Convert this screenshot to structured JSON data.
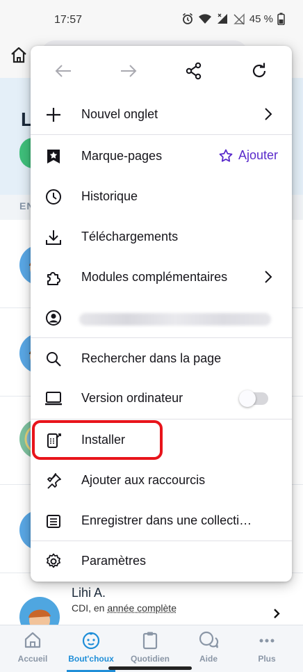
{
  "status_bar": {
    "time": "17:57",
    "battery": "45 %"
  },
  "background_page": {
    "hero_letter": "L",
    "section_label": "EN",
    "last_kid": {
      "name": "Lihi A.",
      "sub_prefix": "CDI, en",
      "sub_link": "année complète"
    },
    "bottom_nav": [
      {
        "label": "Accueil",
        "icon": "house-icon"
      },
      {
        "label": "Bout'choux",
        "icon": "baby-face-icon"
      },
      {
        "label": "Quotidien",
        "icon": "clipboard-icon"
      },
      {
        "label": "Aide",
        "icon": "chat-bubbles-icon"
      },
      {
        "label": "Plus",
        "icon": "more-dots-icon"
      }
    ]
  },
  "menu": {
    "toolbar": [
      "back-arrow-icon",
      "forward-arrow-icon",
      "share-icon",
      "reload-icon"
    ],
    "items": {
      "new_tab": "Nouvel onglet",
      "bookmarks": "Marque-pages",
      "bookmarks_add": "Ajouter",
      "history": "Historique",
      "downloads": "Téléchargements",
      "addons": "Modules complémentaires",
      "find_in_page": "Rechercher dans la page",
      "desktop_site": "Version ordinateur",
      "install": "Installer",
      "add_shortcut": "Ajouter aux raccourcis",
      "save_collection": "Enregistrer dans une collecti…",
      "settings": "Paramètres"
    },
    "desktop_site_enabled": false
  },
  "colors": {
    "accent_purple": "#592acb",
    "highlight_red": "#e8141b",
    "nav_active": "#1f8ed8"
  }
}
